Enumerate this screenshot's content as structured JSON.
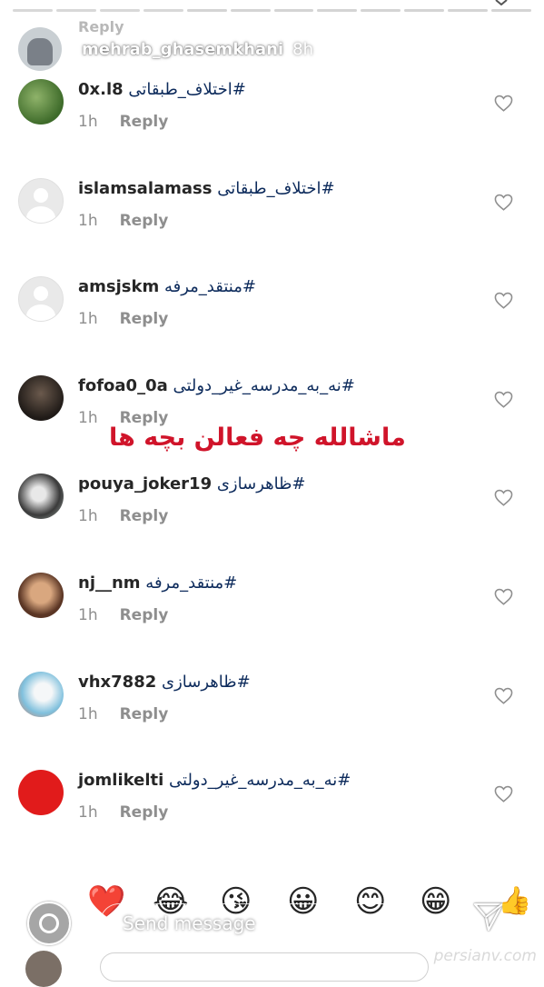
{
  "story": {
    "ghost_row_text": "Reply",
    "poster_name": "mehrab_ghasemkhani",
    "poster_time": "8h"
  },
  "comments": [
    {
      "username": "0x.l8",
      "hashtag": "#اختلاف_طبقاتی",
      "time": "1h",
      "reply": "Reply"
    },
    {
      "username": "islamsalamass",
      "hashtag": "#اختلاف_طبقاتی",
      "time": "1h",
      "reply": "Reply"
    },
    {
      "username": "amsjskm",
      "hashtag": "#منتقد_مرفه",
      "time": "1h",
      "reply": "Reply"
    },
    {
      "username": "fofoa0_0a",
      "hashtag": "#نه_به_مدرسه_غیر_دولتی",
      "time": "1h",
      "reply": "Reply"
    },
    {
      "username": "pouya_joker19",
      "hashtag": "#ظاهرسازی",
      "time": "1h",
      "reply": "Reply"
    },
    {
      "username": "nj__nm",
      "hashtag": "#منتقد_مرفه",
      "time": "1h",
      "reply": "Reply"
    },
    {
      "username": "vhx7882",
      "hashtag": "#ظاهرسازی",
      "time": "1h",
      "reply": "Reply"
    },
    {
      "username": "jomlikelti",
      "hashtag": "#نه_به_مدرسه_غیر_دولتی",
      "time": "1h",
      "reply": "Reply"
    }
  ],
  "overlay_caption": "ماشالله چه فعالن بچه ها",
  "composer": {
    "placeholder": "Send message",
    "quick_emojis": [
      "❤️",
      "😂",
      "😘",
      "😀",
      "😊",
      "😁"
    ]
  },
  "watermark": "persianv.com",
  "colors": {
    "hashtag": "#0d2b5c",
    "meta": "#8e8e8e",
    "caption": "#d0142a"
  }
}
